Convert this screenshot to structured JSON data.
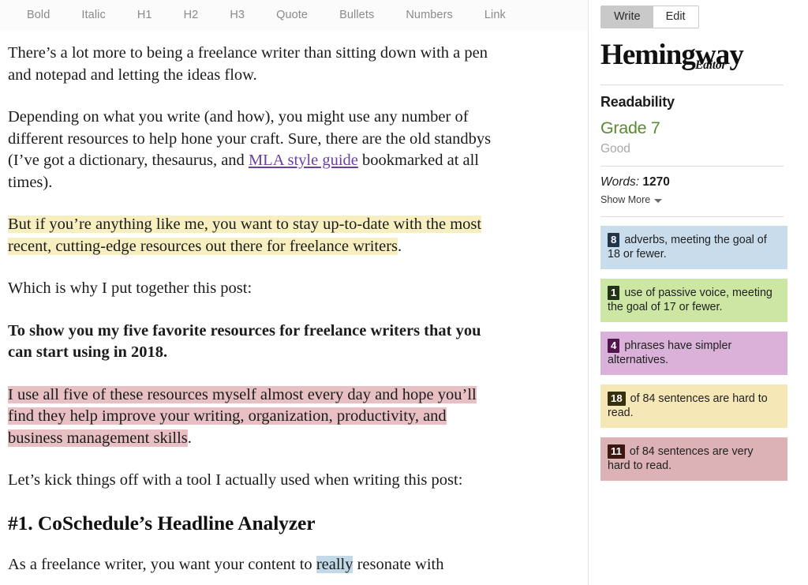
{
  "toolbar": {
    "items": [
      {
        "label": "Bold",
        "name": "format-bold"
      },
      {
        "label": "Italic",
        "name": "format-italic"
      },
      {
        "label": "H1",
        "name": "format-h1"
      },
      {
        "label": "H2",
        "name": "format-h2"
      },
      {
        "label": "H3",
        "name": "format-h3"
      },
      {
        "label": "Quote",
        "name": "format-quote"
      },
      {
        "label": "Bullets",
        "name": "format-bullets"
      },
      {
        "label": "Numbers",
        "name": "format-numbers"
      },
      {
        "label": "Link",
        "name": "format-link"
      }
    ]
  },
  "document": {
    "p1": "There’s a lot more to being a freelance writer than sitting down with a pen and notepad and letting the ideas flow.",
    "p2_a": "Depending on what you write (and how), you might use any number of different resources to help hone your craft. Sure, there are the old standbys (I’ve got a dictionary, thesaurus, and ",
    "p2_link": "MLA style guide",
    "p2_b": " bookmarked at all times).",
    "p3_highlight": "But if you’re anything like me, you want to stay up-to-date with the most recent, cutting-edge resources out there for freelance writers",
    "p3_tail": ".",
    "p4": "Which is why I put together this post:",
    "p5_bold": "To show you my five favorite resources for freelance writers that you can start using in 2018.",
    "p6_highlight": "I use all five of these resources myself almost every day and hope you’ll find they help improve your writing, organization, productivity, and business management skills",
    "p6_tail": ".",
    "p7": "Let’s kick things off with a tool I actually used when writing this post:",
    "heading": "#1. CoSchedule’s Headline Analyzer",
    "p8_a": "As a freelance writer, you want your content to ",
    "p8_hl": "really",
    "p8_b": " resonate with"
  },
  "sidebar": {
    "mode": {
      "write_label": "Write",
      "edit_label": "Edit",
      "active": "Write"
    },
    "brand": {
      "word": "Hemingway",
      "sub": "Editor"
    },
    "readability": {
      "title": "Readability",
      "grade": "Grade 7",
      "note": "Good",
      "grade_color": "#5a8a32"
    },
    "words": {
      "label": "Words:",
      "value": "1270"
    },
    "show_more_label": "Show More",
    "stats": [
      {
        "name": "stat-adverbs",
        "count": "8",
        "text": " adverbs, meeting the goal of 18 or fewer.",
        "bg": "#c9dceb",
        "badge_bg": "#20354a"
      },
      {
        "name": "stat-passive-voice",
        "count": "1",
        "text": " use of passive voice, meeting the goal of 17 or fewer.",
        "bg": "#cce6a4",
        "badge_bg": "#223318"
      },
      {
        "name": "stat-simpler-phrases",
        "count": "4",
        "text": " phrases have simpler alternatives.",
        "bg": "#d9b1d9",
        "badge_bg": "#52144f"
      },
      {
        "name": "stat-hard-sentences",
        "count": "18",
        "text": " of 84 sentences are hard to read.",
        "bg": "#f5e8b6",
        "badge_bg": "#37300f"
      },
      {
        "name": "stat-very-hard-sentences",
        "count": "11",
        "text": " of 84 sentences are very hard to read.",
        "bg": "#ddb2b6",
        "badge_bg": "#3b1712"
      }
    ]
  },
  "colors": {
    "highlight_yellow": "#f8efc0",
    "highlight_pink": "#e8c0c4",
    "highlight_blue": "#c3d9e8",
    "highlight_purple": "#dfc0df",
    "link_purple": "#6b3fa0"
  }
}
